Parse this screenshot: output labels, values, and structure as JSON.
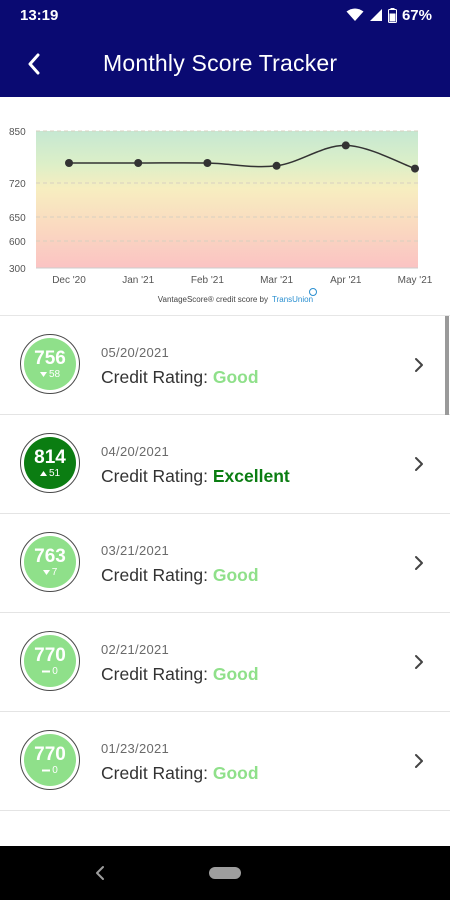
{
  "status_bar": {
    "time": "13:19",
    "battery": "67%",
    "icons": [
      "wifi-icon",
      "signal-icon",
      "battery-icon"
    ]
  },
  "app_bar": {
    "title": "Monthly Score Tracker",
    "back_icon": "back-arrow-icon"
  },
  "chart_data": {
    "type": "line",
    "x": [
      "Dec '20",
      "Jan '21",
      "Feb '21",
      "Mar '21",
      "Apr '21",
      "May '21"
    ],
    "y_ticks": [
      300,
      600,
      650,
      720,
      850
    ],
    "ylim": [
      300,
      850
    ],
    "series": [
      {
        "values": [
          770,
          770,
          770,
          763,
          814,
          756
        ]
      }
    ],
    "background_bands": [
      {
        "from": 300,
        "to": 600,
        "color": "#f9c6c6"
      },
      {
        "from": 600,
        "to": 650,
        "color": "#f9ddc0"
      },
      {
        "from": 650,
        "to": 720,
        "color": "#f7ecbf"
      },
      {
        "from": 720,
        "to": 850,
        "color": "#cdebcf"
      }
    ],
    "grid": "dashed horizontal",
    "attribution": "VantageScore® credit score by",
    "attribution_brand": "TransUnion"
  },
  "history": [
    {
      "score": "756",
      "direction": "down",
      "change": "58",
      "date": "05/20/2021",
      "label": "Credit Rating:",
      "rating": "Good",
      "tier": "good"
    },
    {
      "score": "814",
      "direction": "up",
      "change": "51",
      "date": "04/20/2021",
      "label": "Credit Rating:",
      "rating": "Excellent",
      "tier": "excellent"
    },
    {
      "score": "763",
      "direction": "down",
      "change": "7",
      "date": "03/21/2021",
      "label": "Credit Rating:",
      "rating": "Good",
      "tier": "good"
    },
    {
      "score": "770",
      "direction": "none",
      "change": "0",
      "date": "02/21/2021",
      "label": "Credit Rating:",
      "rating": "Good",
      "tier": "good"
    },
    {
      "score": "770",
      "direction": "none",
      "change": "0",
      "date": "01/23/2021",
      "label": "Credit Rating:",
      "rating": "Good",
      "tier": "good"
    }
  ],
  "colors": {
    "header": "#0a0a72",
    "good": "#8fe08a",
    "excellent": "#0b7d12",
    "line": "#333333"
  }
}
